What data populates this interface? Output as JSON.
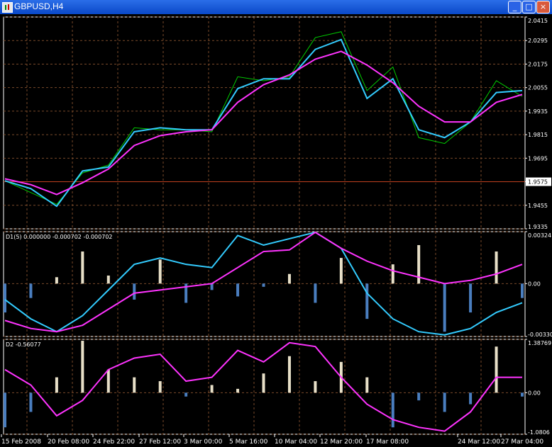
{
  "window": {
    "title": "GBPUSD,H4",
    "minimize_glyph": "_",
    "maximize_glyph": "□",
    "close_glyph": "×",
    "icon": "chart-icon"
  },
  "colors": {
    "background": "#000000",
    "grid": "#7a4a2a",
    "price": "#00cc00",
    "fast_ma": "#33ccff",
    "slow_ma": "#ff33ff",
    "histogram_up": "#e8e0c8",
    "histogram_down": "#4a7ebf",
    "level_line": "#c04020"
  },
  "chart_data": [
    {
      "type": "line",
      "panel": "main",
      "title": "",
      "y_ticks": [
        "2.0415",
        "2.0295",
        "2.0175",
        "2.0055",
        "1.9935",
        "1.9815",
        "1.9695",
        "1.9575",
        "1.9455",
        "1.9335"
      ],
      "ylim": [
        1.9335,
        2.0415
      ],
      "current_price_label": "1.9575",
      "current_price": 1.9575,
      "x": [
        "15 Feb 2008",
        "20 Feb 08:00",
        "24 Feb 22:00",
        "27 Feb 12:00",
        "3 Mar 00:00",
        "5 Mar 16:00",
        "10 Mar 04:00",
        "12 Mar 20:00",
        "17 Mar 08:00",
        "24 Mar 12:00",
        "27 Mar 04:00"
      ],
      "series": [
        {
          "name": "",
          "role": "price",
          "values": [
            1.958,
            1.952,
            1.946,
            1.962,
            1.966,
            1.985,
            1.984,
            1.984,
            1.983,
            2.011,
            2.009,
            2.011,
            2.031,
            2.034,
            2.004,
            2.016,
            1.98,
            1.977,
            1.988,
            2.009,
            2.001
          ]
        },
        {
          "name": "",
          "role": "fast_ma",
          "values": [
            1.958,
            1.954,
            1.945,
            1.963,
            1.965,
            1.983,
            1.985,
            1.984,
            1.984,
            2.005,
            2.01,
            2.01,
            2.025,
            2.03,
            2.0,
            2.01,
            1.984,
            1.98,
            1.988,
            2.003,
            2.004
          ]
        },
        {
          "name": "",
          "role": "slow_ma",
          "values": [
            1.959,
            1.956,
            1.951,
            1.957,
            1.964,
            1.976,
            1.981,
            1.983,
            1.984,
            1.998,
            2.007,
            2.012,
            2.02,
            2.024,
            2.017,
            2.008,
            1.996,
            1.988,
            1.988,
            1.998,
            2.002
          ]
        }
      ]
    },
    {
      "type": "bar",
      "panel": "indicator-1",
      "title": "D1(5) 0.000000 -0.000702 -0.000702",
      "y_ticks": [
        "0.00324",
        "0.00",
        "-0.00330"
      ],
      "ylim": [
        -0.0033,
        0.00324
      ],
      "series": [
        {
          "name": "",
          "role": "histogram",
          "values": [
            -0.0018,
            -0.0009,
            0.0004,
            0.002,
            0.0005,
            -0.001,
            0.0015,
            -0.0012,
            -0.0004,
            -0.0008,
            -0.0002,
            0.0006,
            -0.0012,
            0.0016,
            -0.0022,
            0.0012,
            0.0024,
            -0.003,
            -0.0018,
            0.002,
            -0.0009
          ]
        },
        {
          "name": "",
          "role": "fast_line",
          "values": [
            -0.001,
            -0.0022,
            -0.003,
            -0.002,
            -0.0004,
            0.0012,
            0.0016,
            0.0012,
            0.001,
            0.003,
            0.0024,
            0.0028,
            0.0032,
            0.0022,
            -0.0006,
            -0.0022,
            -0.003,
            -0.0032,
            -0.0028,
            -0.0018,
            -0.0012
          ]
        },
        {
          "name": "",
          "role": "slow_line",
          "values": [
            -0.0023,
            -0.0028,
            -0.003,
            -0.0026,
            -0.0016,
            -0.0006,
            -0.0004,
            -0.0002,
            0.0,
            0.001,
            0.002,
            0.0021,
            0.0032,
            0.0022,
            0.0014,
            0.0008,
            0.0004,
            0.0,
            0.0002,
            0.0006,
            0.0012
          ]
        }
      ]
    },
    {
      "type": "bar",
      "panel": "indicator-2",
      "title": "D2 -0.56077",
      "y_ticks": [
        "1.38769",
        "0.00",
        "-1.0806"
      ],
      "ylim": [
        -1.0806,
        1.38769
      ],
      "series": [
        {
          "name": "",
          "role": "histogram",
          "values": [
            -0.9,
            -0.5,
            0.4,
            1.35,
            0.6,
            0.4,
            0.3,
            -0.1,
            0.2,
            0.1,
            0.5,
            0.95,
            0.3,
            0.8,
            0.4,
            -0.9,
            -0.2,
            -0.5,
            -0.3,
            1.2,
            -0.1
          ]
        },
        {
          "name": "",
          "role": "line",
          "values": [
            0.6,
            0.2,
            -0.6,
            -0.2,
            0.6,
            0.9,
            1.0,
            0.3,
            0.4,
            1.1,
            0.8,
            1.3,
            1.2,
            0.4,
            -0.3,
            -0.7,
            -0.9,
            -1.0,
            -0.5,
            0.4,
            0.4
          ]
        }
      ]
    }
  ]
}
